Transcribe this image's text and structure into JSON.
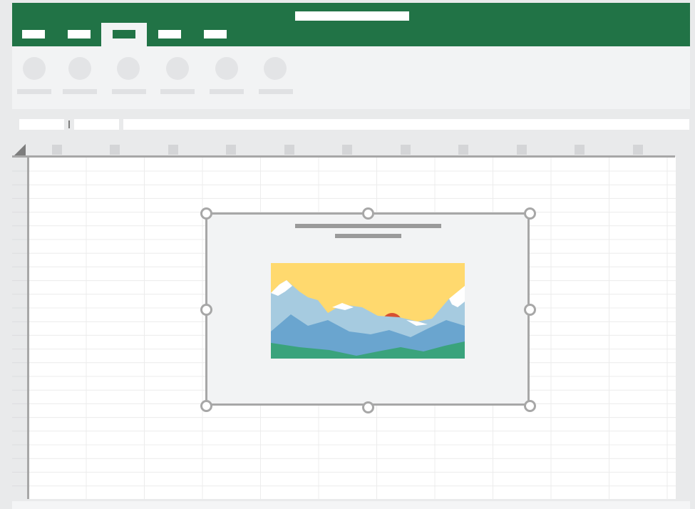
{
  "app": {
    "brand_color": "#217346",
    "tab_count": 5,
    "active_tab_index": 2
  },
  "ribbon": {
    "icons": [
      "ribbon-command-icon",
      "ribbon-command-icon",
      "ribbon-command-icon",
      "ribbon-command-icon",
      "ribbon-command-icon",
      "ribbon-command-icon"
    ]
  },
  "sheet": {
    "grid_color": "#ececec",
    "frame_color": "#a7a7a7"
  },
  "picture": {
    "sky_color": "#ffd96e",
    "sun_color": "#d75032",
    "far_mountain_color": "#a6cbe0",
    "near_mountain_color": "#6aa5cf",
    "hill_color": "#3aa37c",
    "snow_color": "#ffffff",
    "selected": true
  }
}
